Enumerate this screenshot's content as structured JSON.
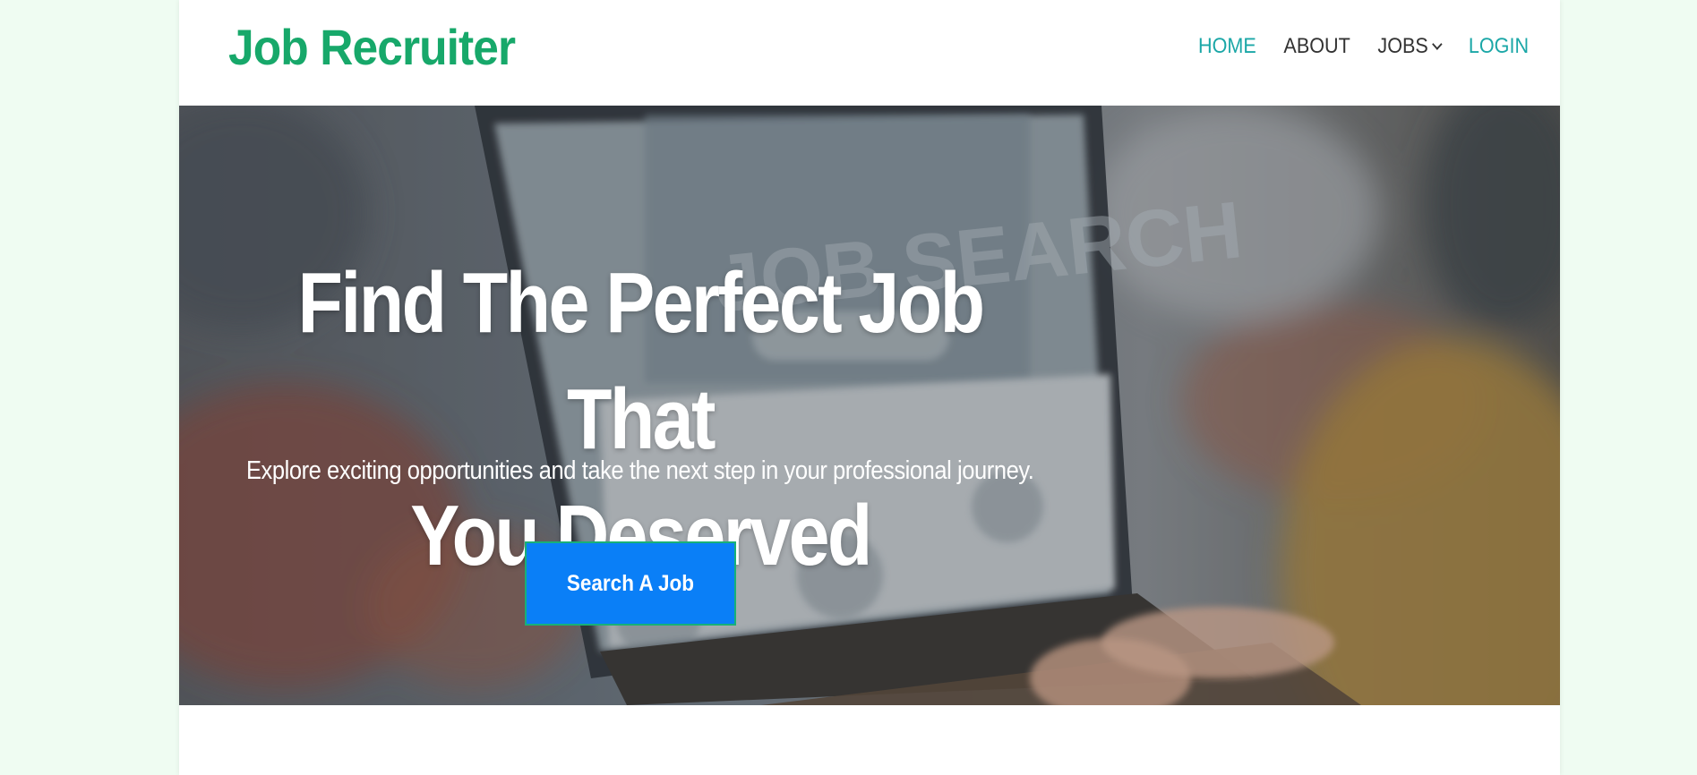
{
  "brand": {
    "name": "Job Recruiter",
    "color": "#17a86a"
  },
  "nav": {
    "items": [
      {
        "label": "HOME",
        "accent": true
      },
      {
        "label": "ABOUT",
        "accent": false
      },
      {
        "label": "JOBS",
        "accent": false,
        "icon": "chevron-down-icon"
      },
      {
        "label": "LOGIN",
        "accent": true
      }
    ],
    "accent_color": "#1ba7a7"
  },
  "hero": {
    "title_line1": "Find The Perfect Job That",
    "title_line2": "You Deserved",
    "subtitle": "Explore exciting opportunities and take the next step in your professional journey.",
    "cta_label": "Search A Job",
    "cta_color": "#0a7ff7",
    "background_image": "laptop-job-search-photo"
  }
}
